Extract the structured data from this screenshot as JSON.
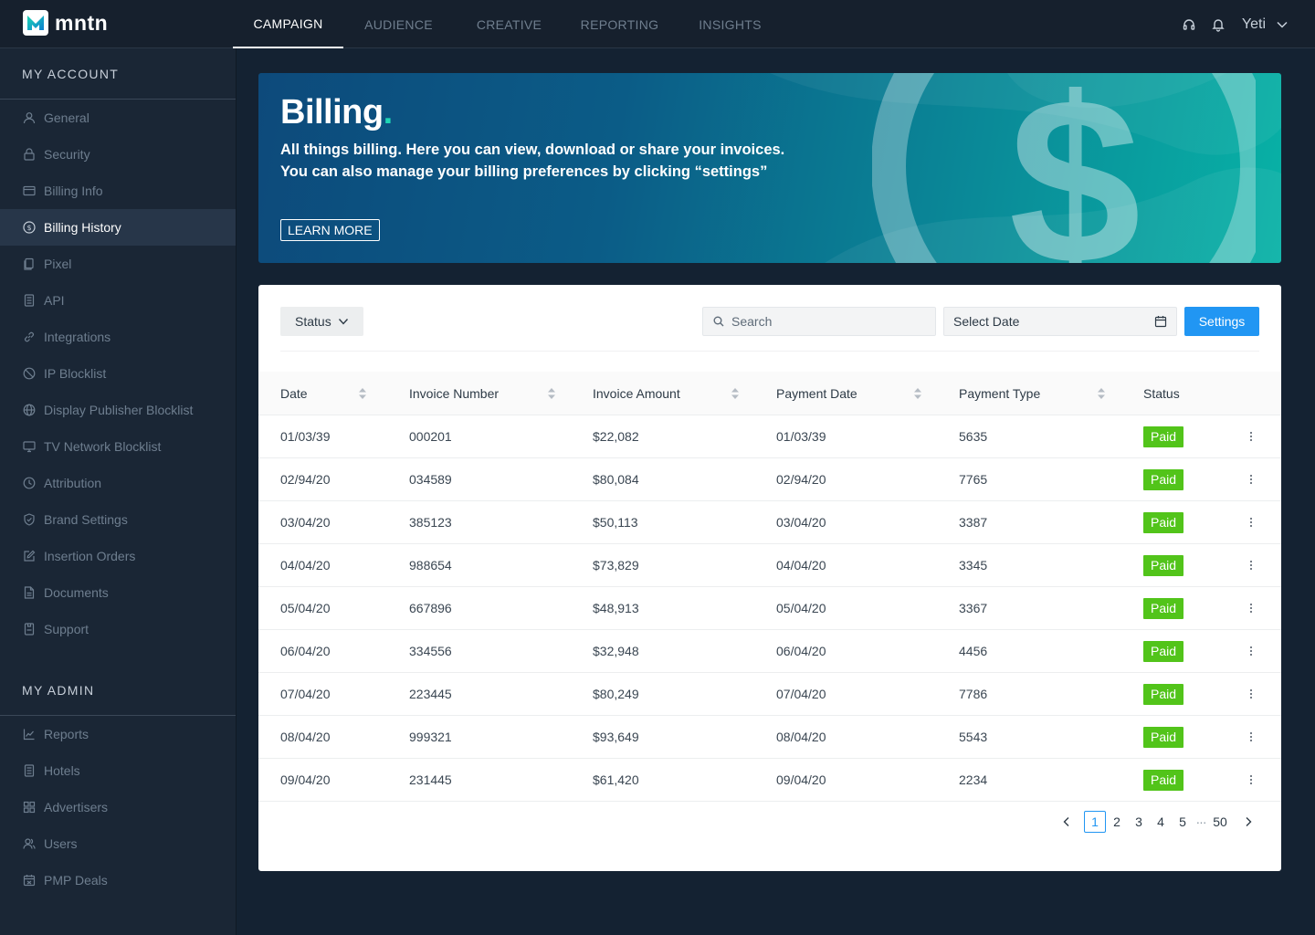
{
  "brand": {
    "name": "mntn",
    "accent": "#1ed6b5"
  },
  "nav": {
    "tabs": [
      {
        "label": "CAMPAIGN",
        "active": true
      },
      {
        "label": "AUDIENCE"
      },
      {
        "label": "CREATIVE"
      },
      {
        "label": "REPORTING"
      },
      {
        "label": "INSIGHTS"
      }
    ],
    "icons": [
      "headset-icon",
      "bell-icon"
    ],
    "user": "Yeti"
  },
  "sidebar": {
    "account_heading": "MY ACCOUNT",
    "account_items": [
      {
        "label": "General",
        "icon": "user-icon"
      },
      {
        "label": "Security",
        "icon": "lock-icon"
      },
      {
        "label": "Billing Info",
        "icon": "credit-card-icon"
      },
      {
        "label": "Billing History",
        "icon": "dollar-circle-icon",
        "active": true
      },
      {
        "label": "Pixel",
        "icon": "copy-icon"
      },
      {
        "label": "API",
        "icon": "document-icon"
      },
      {
        "label": "Integrations",
        "icon": "link-icon"
      },
      {
        "label": "IP Blocklist",
        "icon": "block-icon"
      },
      {
        "label": "Display Publisher Blocklist",
        "icon": "globe-icon"
      },
      {
        "label": "TV Network Blocklist",
        "icon": "monitor-icon"
      },
      {
        "label": "Attribution",
        "icon": "clock-icon"
      },
      {
        "label": "Brand Settings",
        "icon": "shield-check-icon"
      },
      {
        "label": "Insertion Orders",
        "icon": "edit-icon"
      },
      {
        "label": "Documents",
        "icon": "file-icon"
      },
      {
        "label": "Support",
        "icon": "support-icon"
      }
    ],
    "admin_heading": "MY ADMIN",
    "admin_items": [
      {
        "label": "Reports",
        "icon": "line-chart-icon"
      },
      {
        "label": "Hotels",
        "icon": "building-icon"
      },
      {
        "label": "Advertisers",
        "icon": "grid-icon"
      },
      {
        "label": "Users",
        "icon": "users-icon"
      },
      {
        "label": "PMP Deals",
        "icon": "calendar-icon"
      }
    ]
  },
  "banner": {
    "title": "Billing",
    "title_dot": ".",
    "description": "All things billing. Here you can view, download or share your invoices. You can also manage your billing preferences by clicking “settings”",
    "cta": "LEARN MORE",
    "art_icon": "dollar-circle-icon"
  },
  "filters": {
    "status_label": "Status",
    "search_placeholder": "Search",
    "date_placeholder": "Select Date",
    "settings_label": "Settings"
  },
  "table": {
    "columns": [
      "Date",
      "Invoice Number",
      "Invoice Amount",
      "Payment Date",
      "Payment Type",
      "Status"
    ],
    "rows": [
      [
        "01/03/39",
        "000201",
        "$22,082",
        "01/03/39",
        "5635",
        "Paid"
      ],
      [
        "02/94/20",
        "034589",
        "$80,084",
        "02/94/20",
        "7765",
        "Paid"
      ],
      [
        "03/04/20",
        "385123",
        "$50,113",
        "03/04/20",
        "3387",
        "Paid"
      ],
      [
        "04/04/20",
        "988654",
        "$73,829",
        "04/04/20",
        "3345",
        "Paid"
      ],
      [
        "05/04/20",
        "667896",
        "$48,913",
        "05/04/20",
        "3367",
        "Paid"
      ],
      [
        "06/04/20",
        "334556",
        "$32,948",
        "06/04/20",
        "4456",
        "Paid"
      ],
      [
        "07/04/20",
        "223445",
        "$80,249",
        "07/04/20",
        "7786",
        "Paid"
      ],
      [
        "08/04/20",
        "999321",
        "$93,649",
        "08/04/20",
        "5543",
        "Paid"
      ],
      [
        "09/04/20",
        "231445",
        "$61,420",
        "09/04/20",
        "2234",
        "Paid"
      ]
    ],
    "status_color": "#52c41a"
  },
  "pagination": {
    "pages": [
      "1",
      "2",
      "3",
      "4",
      "5"
    ],
    "current": "1",
    "ellipsis": "···",
    "last": "50"
  }
}
